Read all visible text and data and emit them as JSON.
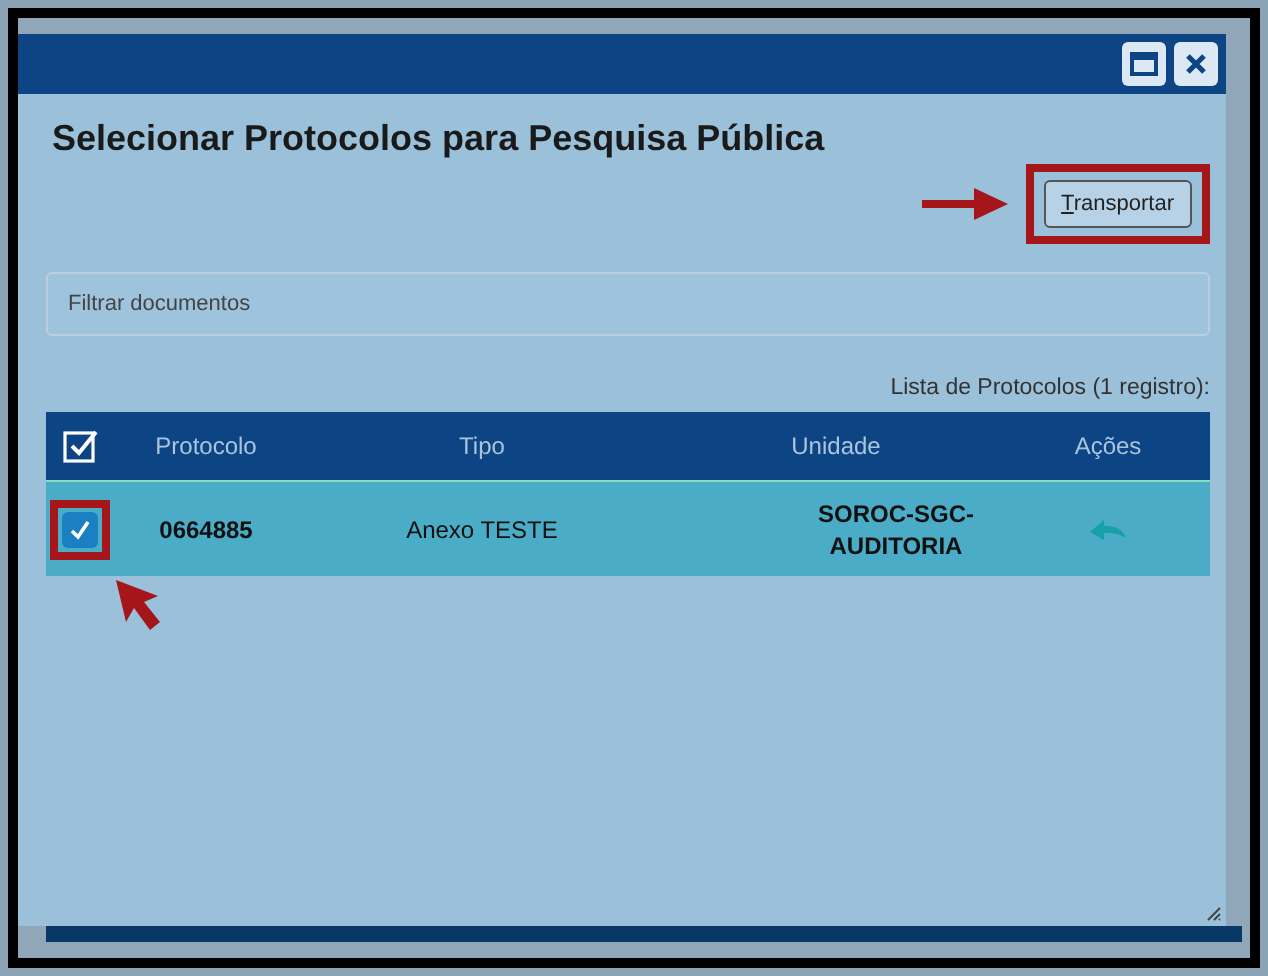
{
  "dialog": {
    "title": "Selecionar Protocolos para Pesquisa Pública",
    "action_button": "Transportar",
    "filter": {
      "placeholder": "Filtrar documentos"
    },
    "caption": "Lista de Protocolos (1 registro):"
  },
  "table": {
    "select_all_checked": true,
    "columns": [
      "Protocolo",
      "Tipo",
      "Unidade",
      "Ações"
    ],
    "rows": [
      {
        "selected": true,
        "checked": true,
        "protocolo": "0664885",
        "tipo": "Anexo TESTE",
        "unidade": "SOROC-SGC-AUDITORIA"
      }
    ]
  }
}
